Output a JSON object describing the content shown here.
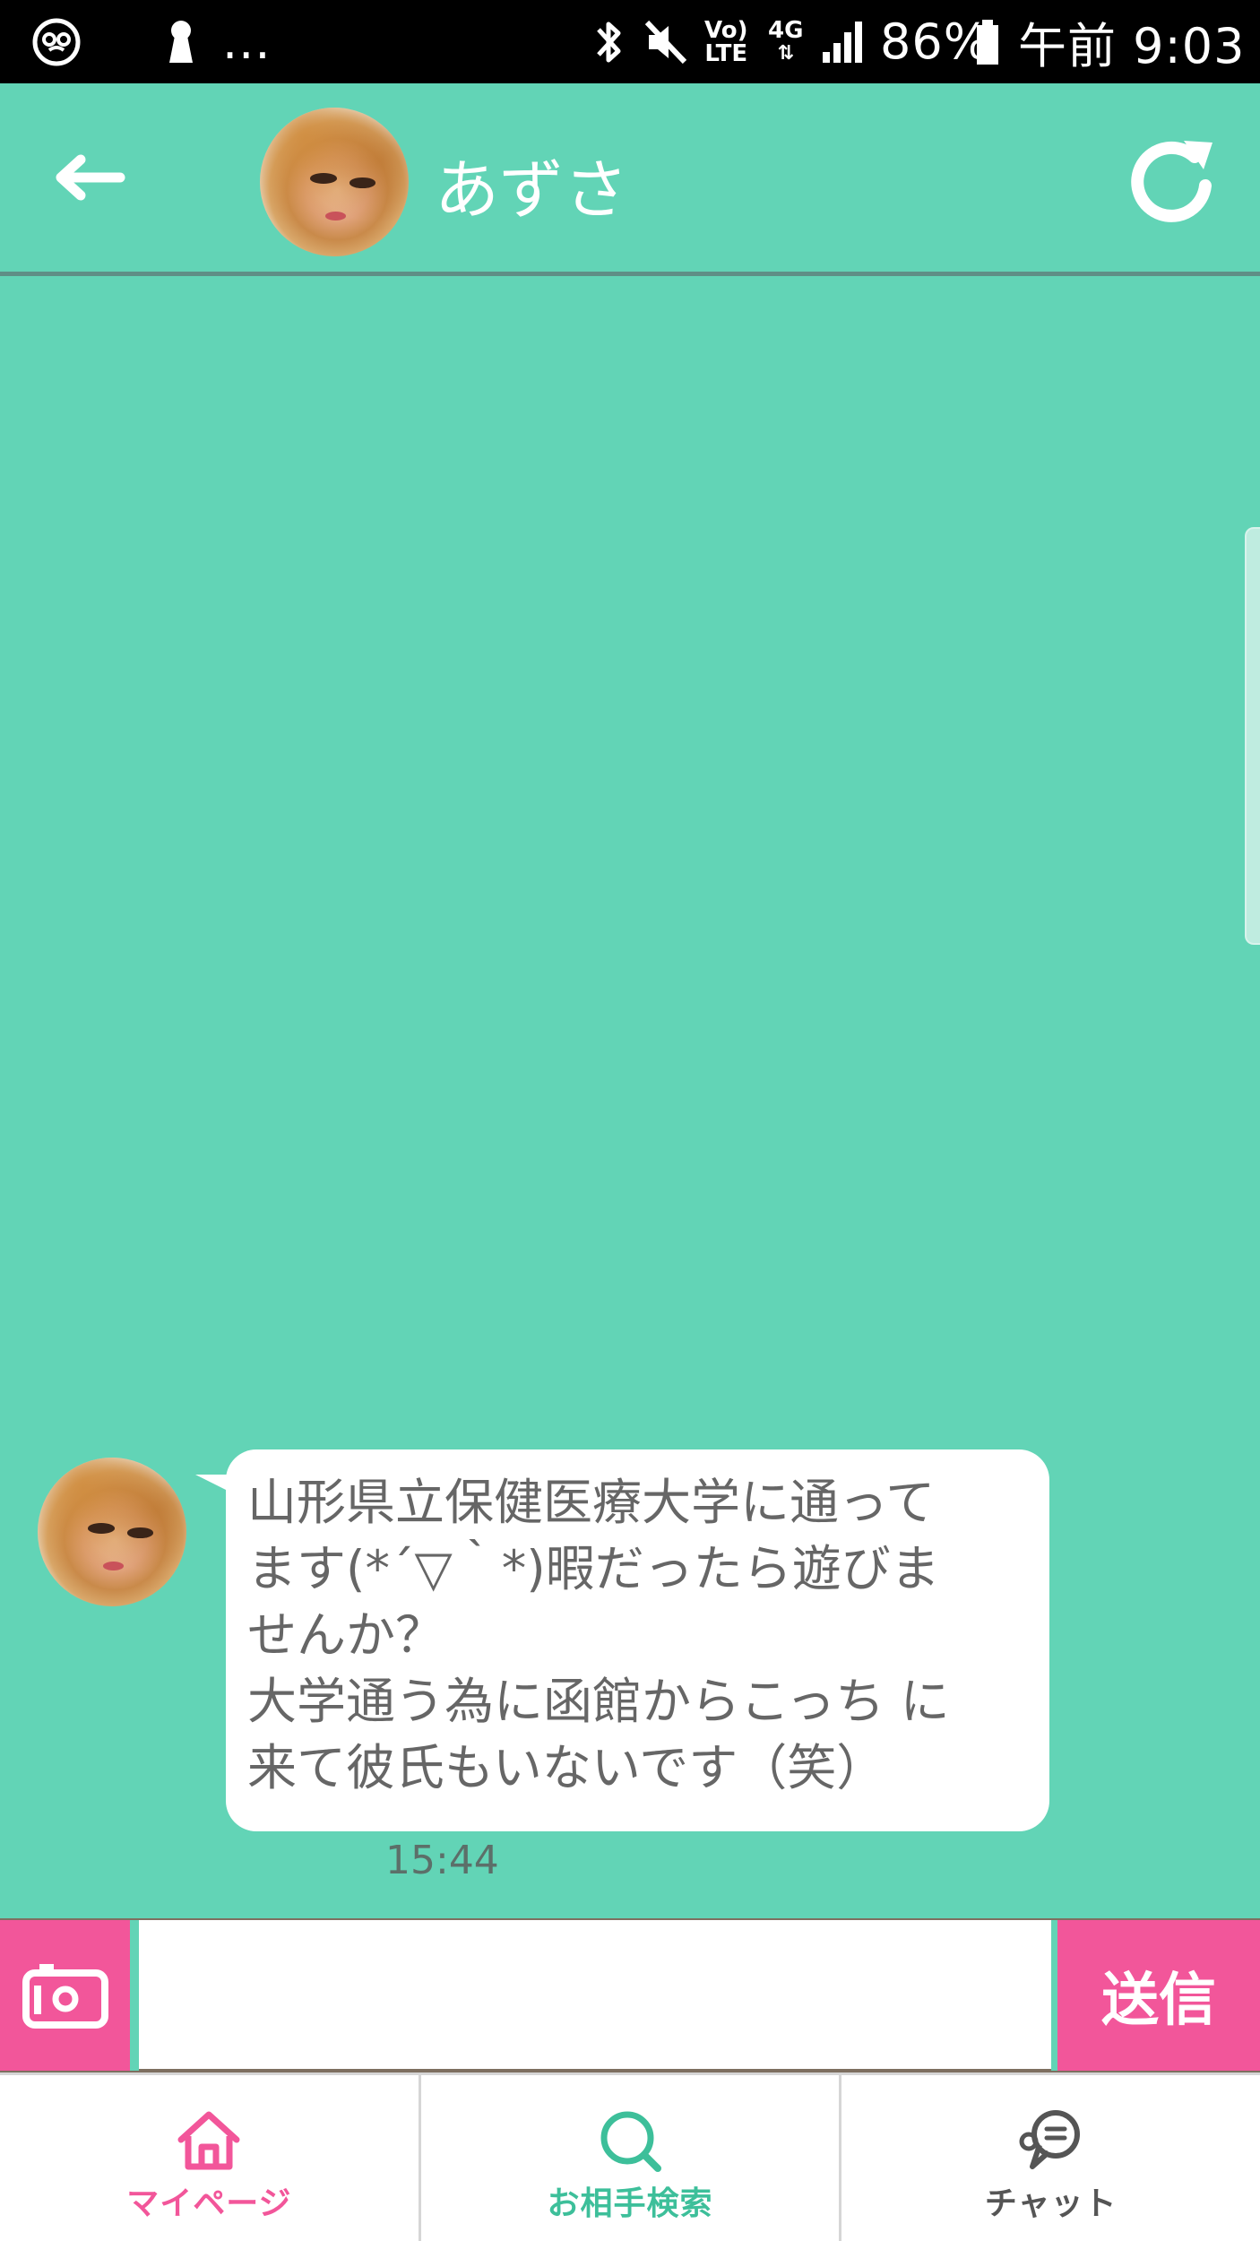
{
  "status_bar": {
    "dots": "...",
    "network_top": "Vo)",
    "network_bottom": "LTE",
    "network_type": "4G",
    "battery": "86%",
    "time": "午前 9:03",
    "icons": [
      "pretzel-icon",
      "keyhole-icon",
      "bluetooth-icon",
      "mute-icon",
      "signal-icon",
      "battery-icon"
    ]
  },
  "header": {
    "contact_name": "あずさ",
    "back_icon": "arrow-left-icon",
    "refresh_icon": "refresh-icon"
  },
  "messages": [
    {
      "text": "山形県立保健医療大学に通って\nます(*´▽｀*)暇だったら遊びま\nせんか？\n大学通う為に函館からこっち に\n来て彼氏もいないです（笑）",
      "time": "15:44"
    }
  ],
  "input_bar": {
    "value": "",
    "send_label": "送信",
    "camera_icon": "camera-icon"
  },
  "bottom_nav": {
    "items": [
      {
        "label": "マイページ",
        "icon": "home-icon",
        "color": "#f2569a"
      },
      {
        "label": "お相手検索",
        "icon": "search-icon",
        "color": "#3dbf9a"
      },
      {
        "label": "チャット",
        "icon": "chat-bubble-icon",
        "color": "#555555"
      }
    ]
  },
  "colors": {
    "accent": "#62d4b6",
    "pink": "#f2569a"
  }
}
